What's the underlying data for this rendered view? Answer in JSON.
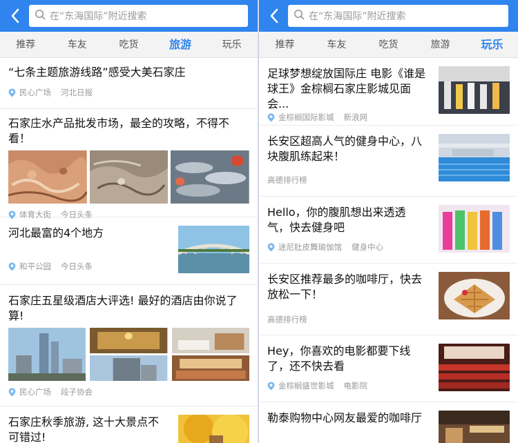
{
  "left": {
    "search_placeholder": "在“东海国际”附近搜索",
    "tabs": [
      {
        "label": "推荐"
      },
      {
        "label": "车友"
      },
      {
        "label": "吃货"
      },
      {
        "label": "旅游"
      },
      {
        "label": "玩乐"
      }
    ],
    "active_tab": "旅游",
    "items": [
      {
        "title": "“七条主题旅游线路”感受大美石家庄",
        "location": "民心广场",
        "source": "河北日报"
      },
      {
        "title": "石家庄水产品批发市场，最全的攻略，不得不看！",
        "location": "体育大街",
        "source": "今日头条"
      },
      {
        "title": "河北最富的4个地方",
        "location": "和平公园",
        "source": "今日头条"
      },
      {
        "title": "石家庄五星级酒店大评选! 最好的酒店由你说了算!",
        "location": "民心广场",
        "source": "段子协会"
      },
      {
        "title": "石家庄秋季旅游, 这十大景点不可错过!"
      }
    ]
  },
  "right": {
    "search_placeholder": "在“东海国际”附近搜索",
    "tabs": [
      {
        "label": "推荐"
      },
      {
        "label": "车友"
      },
      {
        "label": "吃货"
      },
      {
        "label": "旅游"
      },
      {
        "label": "玩乐"
      }
    ],
    "active_tab": "玩乐",
    "items": [
      {
        "title": "足球梦想绽放国际庄 电影《谁是球王》金棕榈石家庄影城见面会...",
        "location": "金棕榈国际影城",
        "source": "新浪网"
      },
      {
        "title": "长安区超高人气的健身中心，八块腹肌练起来！",
        "source": "高德排行榜"
      },
      {
        "title": "Hello，你的腹肌想出来透透气，快去健身吧",
        "location": "迷尼肚皮舞瑜伽馆",
        "source": "健身中心"
      },
      {
        "title": "长安区推荐最多的咖啡厅，快去放松一下！",
        "source": "高德排行榜"
      },
      {
        "title": "Hey，你喜欢的电影都要下线了，还不快去看",
        "location": "金棕榈盛世影城",
        "source": "电影院"
      },
      {
        "title": "勒泰购物中心网友最爱的咖啡厅"
      }
    ]
  },
  "colors": {
    "accent": "#2f84ee",
    "pin": "#7ab8ee"
  }
}
